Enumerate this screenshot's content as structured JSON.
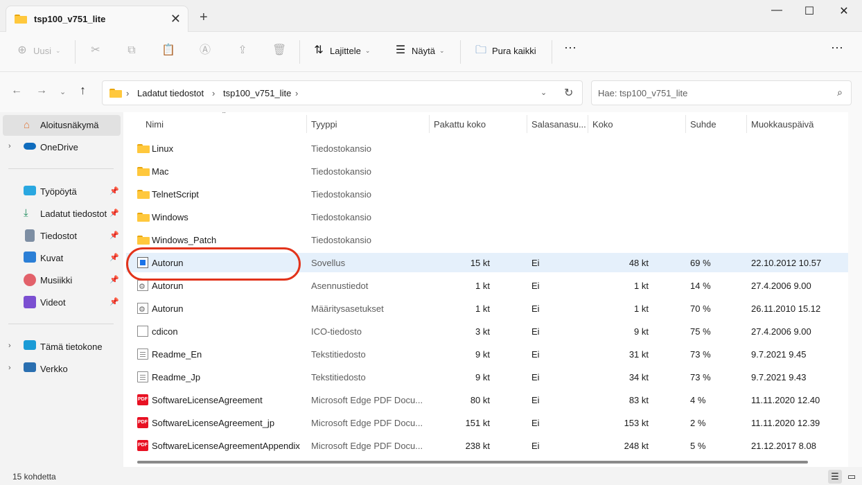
{
  "window": {
    "tab_title": "tsp100_v751_lite",
    "new_tab": "+",
    "close_tab": "✕",
    "minimize": "—",
    "maximize": "☐",
    "close": "✕"
  },
  "toolbar": {
    "new_label": "Uusi",
    "sort_label": "Lajittele",
    "view_label": "Näytä",
    "extract_all_label": "Pura kaikki",
    "more": "···"
  },
  "address": {
    "crumbs": [
      "Ladatut tiedostot",
      "tsp100_v751_lite"
    ],
    "search_placeholder": "Hae: tsp100_v751_lite"
  },
  "sidebar": {
    "items": [
      {
        "label": "Aloitusnäkymä",
        "icon": "home-icon"
      },
      {
        "label": "OneDrive",
        "icon": "cloud-icon"
      },
      {
        "label": "Työpöytä",
        "icon": "desktop-icon"
      },
      {
        "label": "Ladatut tiedostot",
        "icon": "download-icon"
      },
      {
        "label": "Tiedostot",
        "icon": "documents-icon"
      },
      {
        "label": "Kuvat",
        "icon": "pictures-icon"
      },
      {
        "label": "Musiikki",
        "icon": "music-icon"
      },
      {
        "label": "Videot",
        "icon": "videos-icon"
      },
      {
        "label": "Tämä tietokone",
        "icon": "computer-icon"
      },
      {
        "label": "Verkko",
        "icon": "network-icon"
      }
    ]
  },
  "columns": [
    "Nimi",
    "Tyyppi",
    "Pakattu koko",
    "Salasanasu...",
    "Koko",
    "Suhde",
    "Muokkauspäivä"
  ],
  "files": [
    {
      "name": "Linux",
      "type": "Tiedostokansio",
      "packed": "",
      "password": "",
      "size": "",
      "ratio": "",
      "modified": "",
      "icon": "folder-icon"
    },
    {
      "name": "Mac",
      "type": "Tiedostokansio",
      "packed": "",
      "password": "",
      "size": "",
      "ratio": "",
      "modified": "",
      "icon": "folder-icon"
    },
    {
      "name": "TelnetScript",
      "type": "Tiedostokansio",
      "packed": "",
      "password": "",
      "size": "",
      "ratio": "",
      "modified": "",
      "icon": "folder-icon"
    },
    {
      "name": "Windows",
      "type": "Tiedostokansio",
      "packed": "",
      "password": "",
      "size": "",
      "ratio": "",
      "modified": "",
      "icon": "folder-icon"
    },
    {
      "name": "Windows_Patch",
      "type": "Tiedostokansio",
      "packed": "",
      "password": "",
      "size": "",
      "ratio": "",
      "modified": "",
      "icon": "folder-icon"
    },
    {
      "name": "Autorun",
      "type": "Sovellus",
      "packed": "15 kt",
      "password": "Ei",
      "size": "48 kt",
      "ratio": "69 %",
      "modified": "22.10.2012 10.57",
      "icon": "application-icon"
    },
    {
      "name": "Autorun",
      "type": "Asennustiedot",
      "packed": "1 kt",
      "password": "Ei",
      "size": "1 kt",
      "ratio": "14 %",
      "modified": "27.4.2006 9.00",
      "icon": "setup-info-icon"
    },
    {
      "name": "Autorun",
      "type": "Määritysasetukset",
      "packed": "1 kt",
      "password": "Ei",
      "size": "1 kt",
      "ratio": "70 %",
      "modified": "26.11.2010 15.12",
      "icon": "config-settings-icon"
    },
    {
      "name": "cdicon",
      "type": "ICO-tiedosto",
      "packed": "3 kt",
      "password": "Ei",
      "size": "9 kt",
      "ratio": "75 %",
      "modified": "27.4.2006 9.00",
      "icon": "ico-file-icon"
    },
    {
      "name": "Readme_En",
      "type": "Tekstitiedosto",
      "packed": "9 kt",
      "password": "Ei",
      "size": "31 kt",
      "ratio": "73 %",
      "modified": "9.7.2021 9.45",
      "icon": "text-file-icon"
    },
    {
      "name": "Readme_Jp",
      "type": "Tekstitiedosto",
      "packed": "9 kt",
      "password": "Ei",
      "size": "34 kt",
      "ratio": "73 %",
      "modified": "9.7.2021 9.43",
      "icon": "text-file-icon"
    },
    {
      "name": "SoftwareLicenseAgreement",
      "type": "Microsoft Edge PDF Docu...",
      "packed": "80 kt",
      "password": "Ei",
      "size": "83 kt",
      "ratio": "4 %",
      "modified": "11.11.2020 12.40",
      "icon": "pdf-icon"
    },
    {
      "name": "SoftwareLicenseAgreement_jp",
      "type": "Microsoft Edge PDF Docu...",
      "packed": "151 kt",
      "password": "Ei",
      "size": "153 kt",
      "ratio": "2 %",
      "modified": "11.11.2020 12.39",
      "icon": "pdf-icon"
    },
    {
      "name": "SoftwareLicenseAgreementAppendix",
      "type": "Microsoft Edge PDF Docu...",
      "packed": "238 kt",
      "password": "Ei",
      "size": "248 kt",
      "ratio": "5 %",
      "modified": "21.12.2017 8.08",
      "icon": "pdf-icon"
    }
  ],
  "status": {
    "item_count": "15 kohdetta"
  },
  "colors": {
    "highlight_row": "#e5f0fb",
    "annotation": "#e2331b",
    "folder": "#ffc83d"
  }
}
